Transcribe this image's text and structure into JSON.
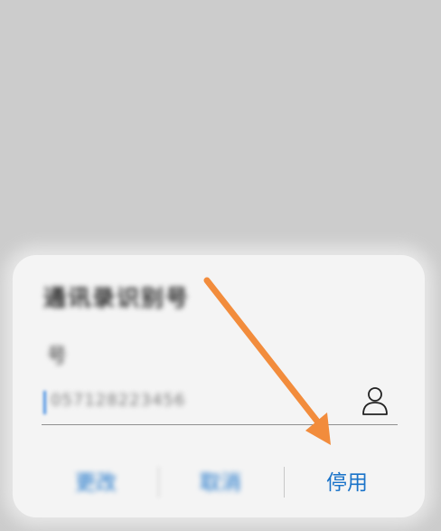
{
  "dialog": {
    "title": "通讯录识别号",
    "subtitle": "号",
    "input": {
      "value": "057128223456"
    },
    "buttons": {
      "modify": "更改",
      "cancel": "取消",
      "disable": "停用"
    }
  },
  "annotation": {
    "arrow_color": "#f28c3c",
    "target": "disable-button"
  },
  "icons": {
    "contact": "person-icon"
  }
}
